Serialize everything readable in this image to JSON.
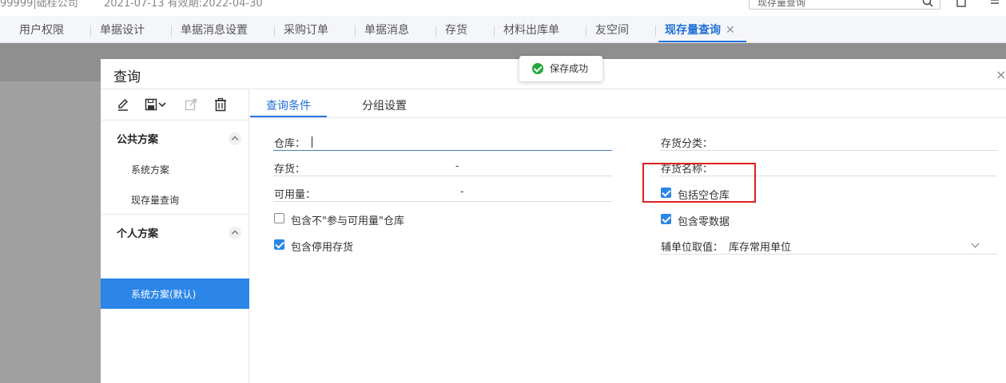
{
  "topbar": {
    "company": "99999|础桂公司",
    "dates": "2021-07-13   有效期:2022-04-30",
    "search_value": "现存量查询"
  },
  "tabs": [
    {
      "label": "用户权限"
    },
    {
      "label": "单据设计"
    },
    {
      "label": "单据消息设置"
    },
    {
      "label": "采购订单"
    },
    {
      "label": "单据消息"
    },
    {
      "label": "存货"
    },
    {
      "label": "材料出库单"
    },
    {
      "label": "友空间"
    },
    {
      "label": "现存量查询",
      "close": "✕"
    }
  ],
  "toast": {
    "text": "保存成功"
  },
  "dialog": {
    "title": "查询",
    "close": "×",
    "groups": {
      "public": {
        "label": "公共方案",
        "items": [
          "系统方案",
          "现存量查询"
        ]
      },
      "personal": {
        "label": "个人方案",
        "active_item": "系统方案(默认)"
      }
    },
    "tabs": {
      "conditions": "查询条件",
      "grouping": "分组设置"
    },
    "fields": {
      "warehouse": "仓库：",
      "inventory": "存货：",
      "inventory_dash": "-",
      "available_qty": "可用量：",
      "available_dash": "-",
      "inventory_category": "存货分类：",
      "inventory_name": "存货名称：",
      "aux_unit_label": "辅单位取值：",
      "aux_unit_value": "库存常用单位"
    },
    "checkboxes": {
      "include_non_available_wh": {
        "label": "包含不\"参与可用量\"仓库",
        "checked": false
      },
      "include_disabled_inventory": {
        "label": "包含停用存货",
        "checked": true
      },
      "include_empty_wh": {
        "label": "包括空仓库",
        "checked": true
      },
      "include_zero_data": {
        "label": "包含零数据",
        "checked": true
      }
    }
  },
  "colors": {
    "accent": "#2b86e8",
    "highlight_box": "#e02020",
    "success": "#22a83a"
  },
  "icons": [
    "edit-icon",
    "save-icon",
    "chevron-down-icon",
    "export-icon",
    "delete-icon",
    "search-icon",
    "home-icon",
    "list-icon",
    "check-circle-icon",
    "close-icon"
  ]
}
